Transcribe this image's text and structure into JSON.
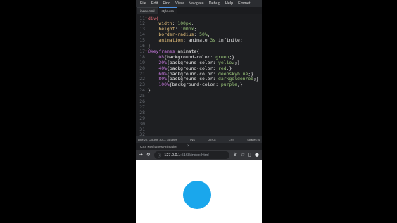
{
  "editor": {
    "menu": [
      "File",
      "Edit",
      "Find",
      "View",
      "Navigate",
      "Debug",
      "Help",
      "Emmet"
    ],
    "tabs": [
      "index.html",
      "style.css"
    ],
    "lines": [
      {
        "n": "11",
        "fold": true,
        "tokens": [
          [
            "sel",
            "div{"
          ]
        ]
      },
      {
        "n": "12",
        "tokens": [
          [
            "plain",
            "    "
          ],
          [
            "prop",
            "width"
          ],
          [
            "plain",
            ": "
          ],
          [
            "val",
            "100px"
          ],
          [
            "plain",
            ";"
          ]
        ]
      },
      {
        "n": "13",
        "tokens": [
          [
            "plain",
            "    "
          ],
          [
            "prop",
            "height"
          ],
          [
            "plain",
            ": "
          ],
          [
            "val",
            "100px"
          ],
          [
            "plain",
            ";"
          ]
        ]
      },
      {
        "n": "14",
        "tokens": [
          [
            "plain",
            "    "
          ],
          [
            "prop",
            "border-radius"
          ],
          [
            "plain",
            ": "
          ],
          [
            "val",
            "50%"
          ],
          [
            "plain",
            ";"
          ]
        ]
      },
      {
        "n": "15",
        "tokens": [
          [
            "plain",
            "    "
          ],
          [
            "prop",
            "animation"
          ],
          [
            "plain",
            ": animate "
          ],
          [
            "val",
            "3s"
          ],
          [
            "plain",
            " infinite;"
          ]
        ]
      },
      {
        "n": "16",
        "tokens": [
          [
            "plain",
            "}"
          ]
        ]
      },
      {
        "n": "17",
        "fold": true,
        "tokens": [
          [
            "kw",
            "@keyframes"
          ],
          [
            "plain",
            " animate{"
          ]
        ]
      },
      {
        "n": "18",
        "tokens": [
          [
            "plain",
            "    "
          ],
          [
            "pct",
            "0%"
          ],
          [
            "plain",
            "{background-color: "
          ],
          [
            "val",
            "green"
          ],
          [
            "plain",
            ";}"
          ]
        ]
      },
      {
        "n": "19",
        "tokens": [
          [
            "plain",
            "    "
          ],
          [
            "pct",
            "20%"
          ],
          [
            "plain",
            "{background-color: "
          ],
          [
            "val",
            "yellow"
          ],
          [
            "plain",
            ";}"
          ]
        ]
      },
      {
        "n": "20",
        "tokens": [
          [
            "plain",
            "    "
          ],
          [
            "pct",
            "40%"
          ],
          [
            "plain",
            "{background-color: "
          ],
          [
            "val",
            "red"
          ],
          [
            "plain",
            ";}"
          ]
        ]
      },
      {
        "n": "21",
        "tokens": [
          [
            "plain",
            "    "
          ],
          [
            "pct",
            "60%"
          ],
          [
            "plain",
            "{background-color: "
          ],
          [
            "val",
            "deepskyblue"
          ],
          [
            "plain",
            ";}"
          ]
        ]
      },
      {
        "n": "22",
        "tokens": [
          [
            "plain",
            "    "
          ],
          [
            "pct",
            "80%"
          ],
          [
            "plain",
            "{background-color: "
          ],
          [
            "val",
            "darkgoldenrod"
          ],
          [
            "plain",
            ";}"
          ]
        ]
      },
      {
        "n": "23",
        "tokens": [
          [
            "plain",
            "    "
          ],
          [
            "pct",
            "100%"
          ],
          [
            "plain",
            "{background-color: "
          ],
          [
            "val",
            "purple"
          ],
          [
            "plain",
            ";}"
          ]
        ]
      },
      {
        "n": "24",
        "tokens": [
          [
            "plain",
            "}"
          ]
        ]
      },
      {
        "n": "25",
        "tokens": []
      },
      {
        "n": "26",
        "tokens": []
      },
      {
        "n": "27",
        "tokens": []
      },
      {
        "n": "28",
        "tokens": []
      },
      {
        "n": "29",
        "tokens": []
      },
      {
        "n": "30",
        "tokens": []
      },
      {
        "n": "31",
        "tokens": []
      },
      {
        "n": "32",
        "tokens": []
      }
    ],
    "status": {
      "left": "Line 20, Column 30 — 35 Lines",
      "ins": "INS",
      "encoding": "UTF-8",
      "mode": "CSS",
      "spaces": "Spaces: 4"
    }
  },
  "browser": {
    "tab_title": "CSS Keyframes Animation",
    "url_host": "127.0.0.1",
    "url_rest": ":5168/index.html",
    "circle_color": "#1aa7ec"
  }
}
